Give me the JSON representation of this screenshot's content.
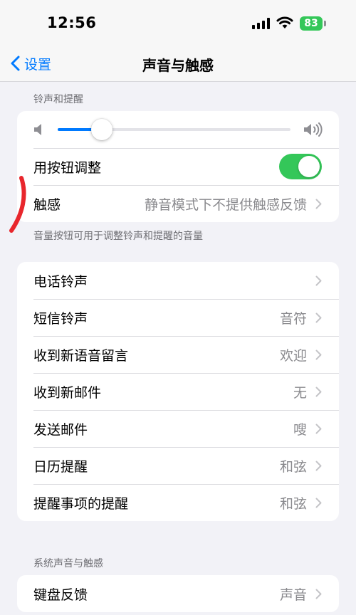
{
  "status": {
    "time": "12:56",
    "battery": "83"
  },
  "nav": {
    "back_label": "设置",
    "title": "声音与触感"
  },
  "ringer": {
    "header": "铃声和提醒",
    "volume_level": 0.19,
    "change_with_buttons_label": "用按钮调整",
    "change_with_buttons_on": true,
    "haptics_label": "触感",
    "haptics_value": "静音模式下不提供触感反馈",
    "footer": "音量按钮可用于调整铃声和提醒的音量"
  },
  "sounds": [
    {
      "label": "电话铃声",
      "value": ""
    },
    {
      "label": "短信铃声",
      "value": "音符"
    },
    {
      "label": "收到新语音留言",
      "value": "欢迎"
    },
    {
      "label": "收到新邮件",
      "value": "无"
    },
    {
      "label": "发送邮件",
      "value": "嗖"
    },
    {
      "label": "日历提醒",
      "value": "和弦"
    },
    {
      "label": "提醒事项的提醒",
      "value": "和弦"
    }
  ],
  "system": {
    "header": "系统声音与触感",
    "keyboard_label": "键盘反馈",
    "keyboard_value": "声音"
  },
  "colors": {
    "accent": "#007aff",
    "toggle_on": "#34c759",
    "annotation": "#e8262c"
  }
}
